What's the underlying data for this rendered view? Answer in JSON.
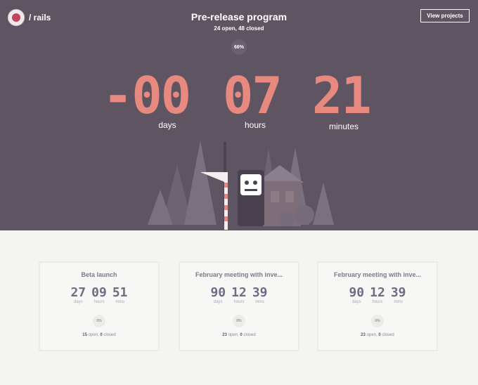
{
  "repo": {
    "name": "/ rails",
    "avatar_label": "RAILS"
  },
  "header": {
    "title": "Pre-release program",
    "summary": "24 open, 48 closed",
    "button": "View projects"
  },
  "progress": {
    "label": "66%",
    "value": 0.66
  },
  "countdown": [
    {
      "value": "-00",
      "label": "days"
    },
    {
      "value": "07",
      "label": "hours"
    },
    {
      "value": "21",
      "label": "minutes"
    }
  ],
  "milestones": [
    {
      "title": "Beta launch",
      "days": "27",
      "hours": "09",
      "mins": "51",
      "days_label": "days",
      "hours_label": "hours",
      "mins_label": "mins",
      "pct": "0%",
      "open": "15",
      "open_label": "open,",
      "closed": "0",
      "closed_label": "closed"
    },
    {
      "title": "February meeting with inve...",
      "days": "90",
      "hours": "12",
      "mins": "39",
      "days_label": "days",
      "hours_label": "hours",
      "mins_label": "mins",
      "pct": "0%",
      "open": "23",
      "open_label": "open,",
      "closed": "0",
      "closed_label": "closed"
    },
    {
      "title": "February meeting with inve...",
      "days": "90",
      "hours": "12",
      "mins": "39",
      "days_label": "days",
      "hours_label": "hours",
      "mins_label": "mins",
      "pct": "0%",
      "open": "23",
      "open_label": "open,",
      "closed": "0",
      "closed_label": "closed"
    }
  ],
  "colors": {
    "hero_bg": "#5f5462",
    "accent": "#e8897f",
    "card_text": "#6f6c85"
  }
}
